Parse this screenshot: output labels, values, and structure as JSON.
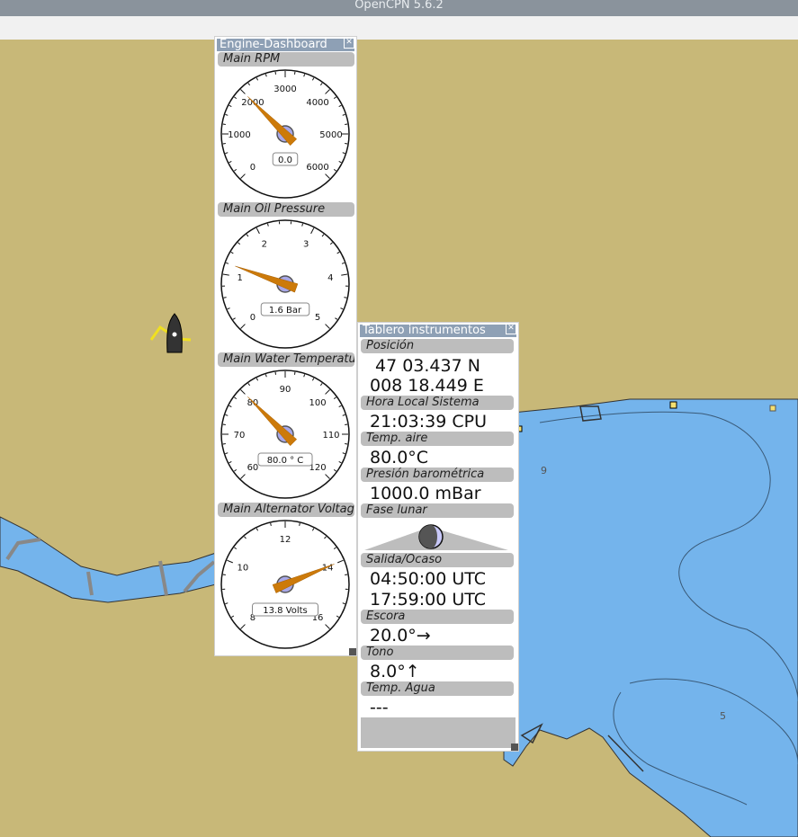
{
  "window": {
    "title": "OpenCPN 5.6.2"
  },
  "chart": {
    "colors": {
      "land": "#c8b878",
      "water": "#74b4ec",
      "route": "#888888"
    },
    "soundings": [
      "9",
      "5"
    ]
  },
  "engine_dashboard": {
    "title": "Engine-Dashboard",
    "gauges": [
      {
        "label": "Main RPM",
        "ticks": [
          "0",
          "1000",
          "2000",
          "3000",
          "4000",
          "5000",
          "6000"
        ],
        "readout": "0.0",
        "min": 0,
        "max": 6000,
        "value": 2000
      },
      {
        "label": "Main Oil Pressure",
        "ticks": [
          "0",
          "1",
          "2",
          "3",
          "4",
          "5"
        ],
        "readout": "1.6 Bar",
        "min": 0,
        "max": 5,
        "value": 1.2
      },
      {
        "label": "Main Water Temperatu",
        "ticks": [
          "60",
          "70",
          "80",
          "90",
          "100",
          "110",
          "120"
        ],
        "readout": "80.0 ° C",
        "min": 60,
        "max": 120,
        "value": 80
      },
      {
        "label": "Main Alternator Voltag",
        "ticks": [
          "8",
          "10",
          "12",
          "14",
          "16"
        ],
        "readout": "13.8 Volts",
        "min": 8,
        "max": 16,
        "value": 14
      }
    ]
  },
  "instruments": {
    "title": "Tablero instrumentos",
    "sections": [
      {
        "label": "Posición",
        "values": [
          "47 03.437 N",
          "008 18.449 E"
        ]
      },
      {
        "label": "Hora Local Sistema",
        "values": [
          "21:03:39 CPU"
        ]
      },
      {
        "label": "Temp. aire",
        "values": [
          "80.0°C"
        ]
      },
      {
        "label": "Presión barométrica",
        "values": [
          "1000.0 mBar"
        ]
      },
      {
        "label": "Fase lunar",
        "values": []
      },
      {
        "label": "Salida/Ocaso",
        "values": [
          "04:50:00 UTC",
          "17:59:00 UTC"
        ]
      },
      {
        "label": "Escora",
        "values": [
          "20.0°→"
        ]
      },
      {
        "label": "Tono",
        "values": [
          "8.0°↑"
        ]
      },
      {
        "label": "Temp. Agua",
        "values": [
          "---"
        ]
      }
    ]
  }
}
